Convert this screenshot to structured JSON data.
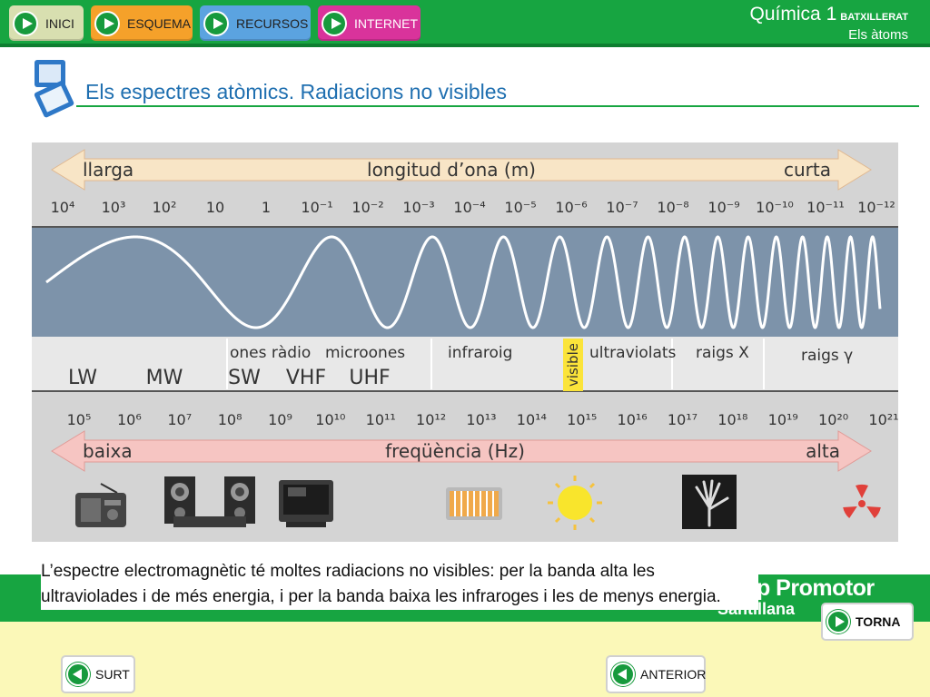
{
  "nav": {
    "inici": "INICI",
    "esquema": "ESQUEMA",
    "recursos": "RECURSOS",
    "internet": "INTERNET"
  },
  "course": {
    "name": "Química 1",
    "level": "BATXILLERAT",
    "unit": "Els àtoms"
  },
  "slide_title": "Els espectres atòmics. Radiacions no visibles",
  "diagram": {
    "wavelength_axis": {
      "left": "llarga",
      "center": "longitud d’ona (m)",
      "right": "curta"
    },
    "wavelength_ticks": [
      "10⁴",
      "10³",
      "10²",
      "10",
      "1",
      "10⁻¹",
      "10⁻²",
      "10⁻³",
      "10⁻⁴",
      "10⁻⁵",
      "10⁻⁶",
      "10⁻⁷",
      "10⁻⁸",
      "10⁻⁹",
      "10⁻¹⁰",
      "10⁻¹¹",
      "10⁻¹²"
    ],
    "bands": {
      "ones_radio": "ones ràdio",
      "microones": "microones",
      "infraroig": "infraroig",
      "visible": "visible",
      "ultraviolats": "ultraviolats",
      "raigs_x": "raigs X",
      "raigs_gamma": "raigs γ"
    },
    "radio_bands": [
      "LW",
      "MW",
      "SW",
      "VHF",
      "UHF"
    ],
    "frequency_ticks": [
      "10⁵",
      "10⁶",
      "10⁷",
      "10⁸",
      "10⁹",
      "10¹⁰",
      "10¹¹",
      "10¹²",
      "10¹³",
      "10¹⁴",
      "10¹⁵",
      "10¹⁶",
      "10¹⁷",
      "10¹⁸",
      "10¹⁹",
      "10²⁰",
      "10²¹"
    ],
    "frequency_axis": {
      "left": "baixa",
      "center": "freqüència (Hz)",
      "right": "alta"
    },
    "colors": {
      "frame": "#d3d3d3",
      "wave_band": "#7d93aa",
      "arrow_top": "#f8e5c6",
      "arrow_bottom": "#f6c5c2",
      "visible": "#fbe43a"
    }
  },
  "caption": "L’espectre electromagnètic té moltes radiacions no visibles: per la banda alta les ultraviolades i de més energia, i per la banda baixa les infraroges i les de menys energia.",
  "brand": {
    "main": "Grup Promotor",
    "sub": "Santillana"
  },
  "buttons": {
    "torna": "TORNA",
    "surt": "SURT",
    "anterior": "ANTERIOR"
  }
}
